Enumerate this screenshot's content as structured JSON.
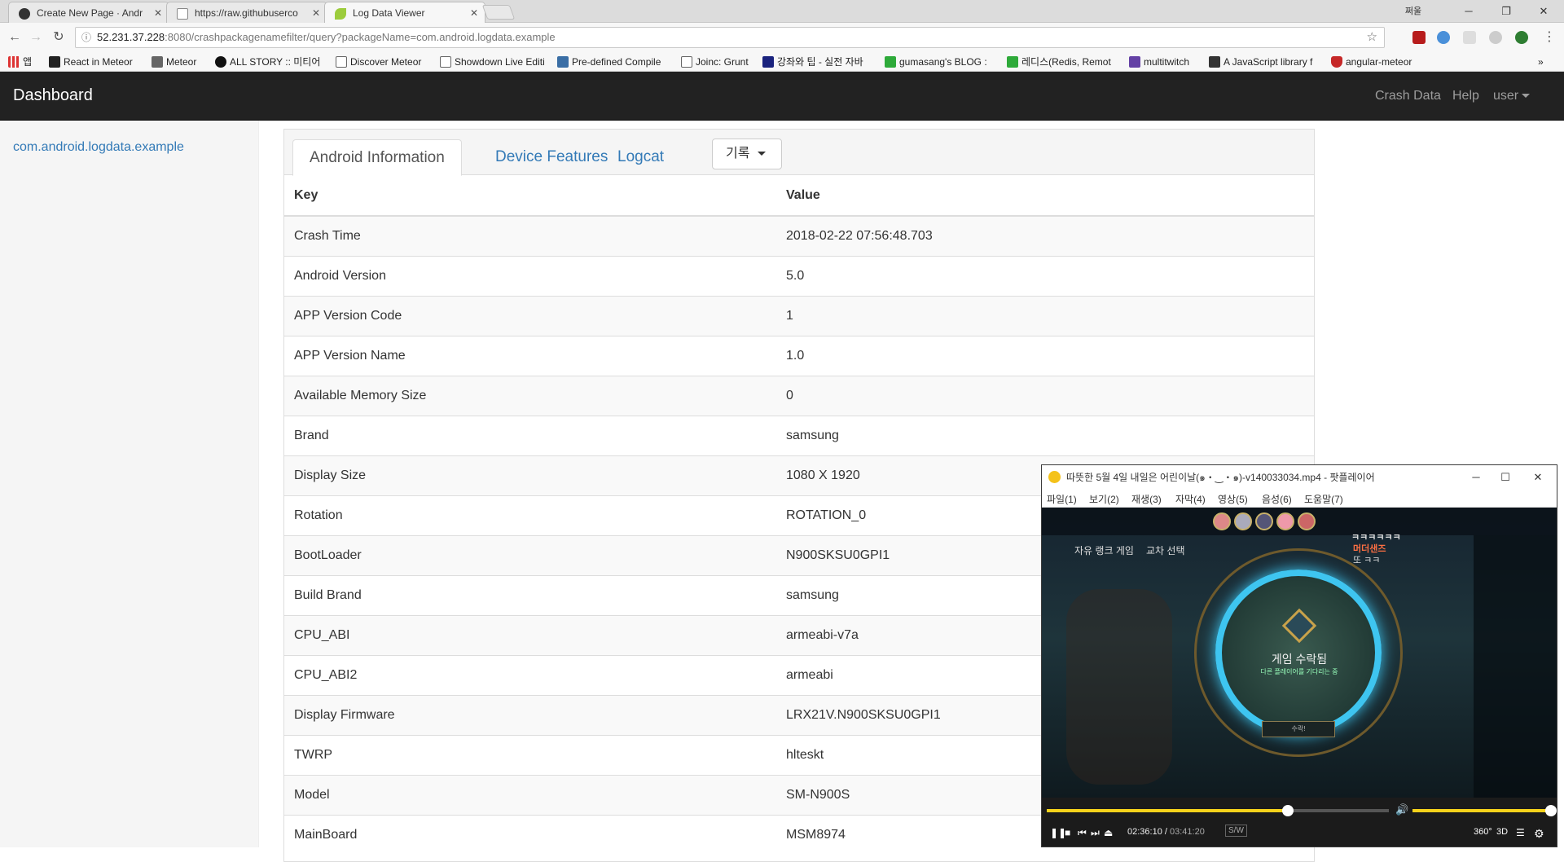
{
  "browser": {
    "tabs": [
      {
        "title": "Create New Page · Andr",
        "icon": "github-icon"
      },
      {
        "title": "https://raw.githubuserco",
        "icon": "page-icon"
      },
      {
        "title": "Log Data Viewer",
        "icon": "leaf-icon"
      }
    ],
    "profile": "쩌울",
    "url_host": "52.231.37.228",
    "url_rest": ":8080/crashpackagenamefilter/query?packageName=com.android.logdata.example",
    "bookmarks": [
      "앱",
      "React in Meteor",
      "Meteor",
      "ALL STORY :: 미티어",
      "Discover Meteor",
      "Showdown Live Editi",
      "Pre-defined Compile",
      "Joinc: Grunt",
      "강좌와 팁 - 실전 자바",
      "gumasang's BLOG :",
      "레디스(Redis, Remot",
      "multitwitch",
      "A JavaScript library f",
      "angular-meteor"
    ],
    "bookmarks_more": "»"
  },
  "navbar": {
    "brand": "Dashboard",
    "links": [
      "Crash Data",
      "Help",
      "user"
    ]
  },
  "sidebar": {
    "package": "com.android.logdata.example"
  },
  "panel": {
    "tabs": [
      "Android Information",
      "Device Features",
      "Logcat"
    ],
    "dropdown": "기록",
    "table": {
      "headers": [
        "Key",
        "Value"
      ],
      "rows": [
        [
          "Crash Time",
          "2018-02-22 07:56:48.703"
        ],
        [
          "Android Version",
          "5.0"
        ],
        [
          "APP Version Code",
          "1"
        ],
        [
          "APP Version Name",
          "1.0"
        ],
        [
          "Available Memory Size",
          "0"
        ],
        [
          "Brand",
          "samsung"
        ],
        [
          "Display Size",
          "1080 X 1920"
        ],
        [
          "Rotation",
          "ROTATION_0"
        ],
        [
          "BootLoader",
          "N900SKSU0GPI1"
        ],
        [
          "Build Brand",
          "samsung"
        ],
        [
          "CPU_ABI",
          "armeabi-v7a"
        ],
        [
          "CPU_ABI2",
          "armeabi"
        ],
        [
          "Display Firmware",
          "LRX21V.N900SKSU0GPI1"
        ],
        [
          "TWRP",
          "hlteskt"
        ],
        [
          "Model",
          "SM-N900S"
        ],
        [
          "MainBoard",
          "MSM8974"
        ]
      ]
    }
  },
  "player": {
    "title": "따뜻한 5월 4일 내일은 어린이날(๑・‿・๑)-v140033034.mp4 - 팟플레이어",
    "menu": [
      "파일(1)",
      "보기(2)",
      "재생(3)",
      "자막(4)",
      "영상(5)",
      "음성(6)",
      "도움말(7)"
    ],
    "video": {
      "mode": "자유 랭크 게임",
      "pick": "교차 선택",
      "accepted": "게임 수락됨",
      "sub": "다른 플레이어를 기다리는 중",
      "button": "수락!",
      "overlay1": "ㅋㅋㅋㅋㅋㅋ",
      "overlay2": "머더샌즈",
      "overlay3": "또 ㅋㅋ"
    },
    "time_current": "02:36:10",
    "time_total": "03:41:20",
    "sw": "S/W",
    "badge_360": "360°",
    "badge_3d": "3D",
    "progress": 0.705,
    "volume": 1.0
  }
}
